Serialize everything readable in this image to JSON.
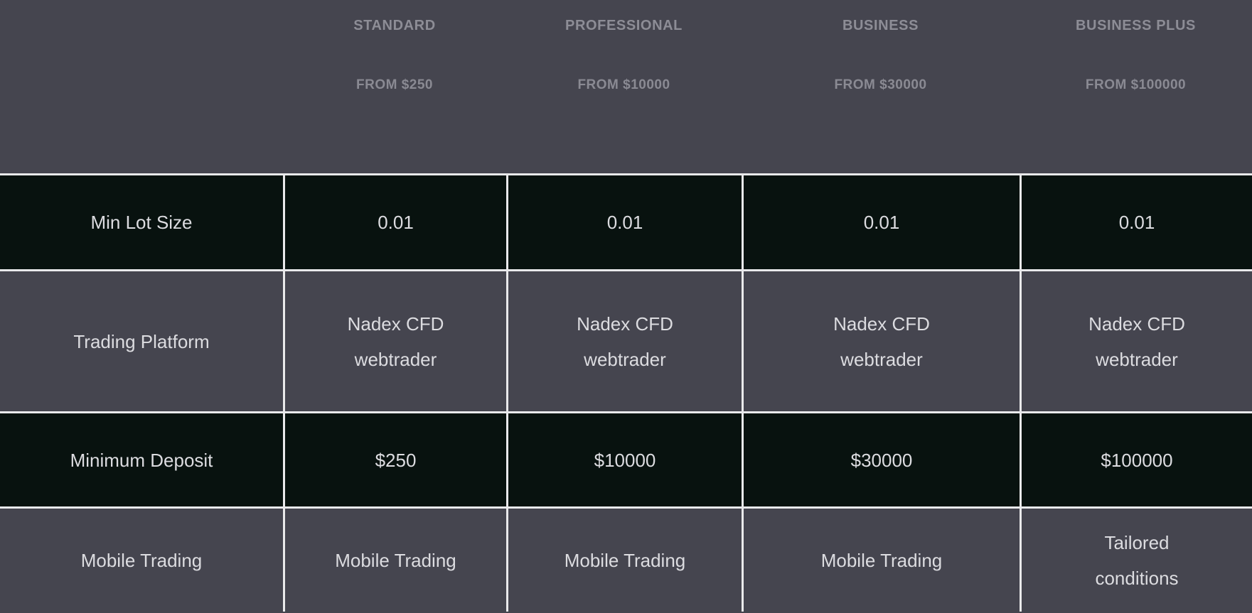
{
  "header": {
    "label_column": "",
    "plans": [
      {
        "name": "STANDARD",
        "from": "FROM $250"
      },
      {
        "name": "PROFESSIONAL",
        "from": "FROM $10000"
      },
      {
        "name": "BUSINESS",
        "from": "FROM $30000"
      },
      {
        "name": "BUSINESS PLUS",
        "from": "FROM $100000"
      }
    ]
  },
  "colors": {
    "page_background": "#45454f",
    "header_text": "#8d8d96",
    "row_dark": "#08120f",
    "row_light": "#45454f",
    "grid_border": "#e9e9eb",
    "cell_text": "#dcdce0"
  },
  "table": {
    "rows": [
      {
        "label": "Min Lot Size",
        "style": "dark",
        "height": "h1",
        "values": [
          "0.01",
          "0.01",
          "0.01",
          "0.01"
        ]
      },
      {
        "label": "Trading Platform",
        "style": "light",
        "height": "h2",
        "values": [
          "Nadex CFD\nwebtrader",
          "Nadex CFD\nwebtrader",
          "Nadex CFD\nwebtrader",
          "Nadex CFD\nwebtrader"
        ]
      },
      {
        "label": "Minimum Deposit",
        "style": "dark",
        "height": "h3",
        "values": [
          "$250",
          "$10000",
          "$30000",
          "$100000"
        ]
      },
      {
        "label": "Mobile Trading",
        "style": "light",
        "height": "h4",
        "values": [
          "Mobile Trading",
          "Mobile Trading",
          "Mobile Trading",
          "Tailored\nconditions"
        ]
      }
    ]
  }
}
